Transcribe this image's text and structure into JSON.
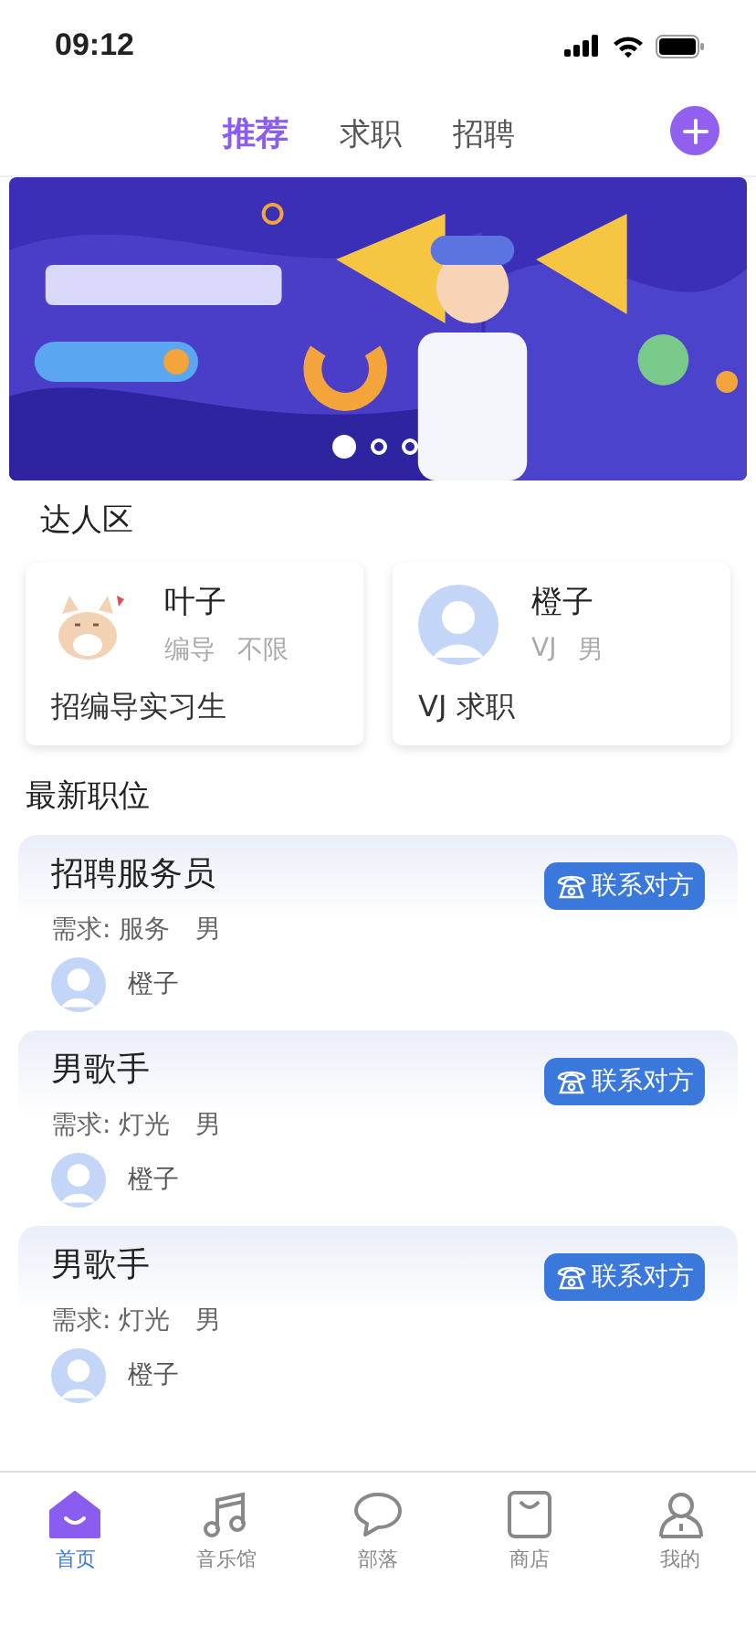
{
  "status_bar": {
    "time": "09:12"
  },
  "top_tabs": [
    {
      "label": "推荐",
      "selected": true
    },
    {
      "label": "求职",
      "selected": false
    },
    {
      "label": "招聘",
      "selected": false
    }
  ],
  "banner": {
    "kind": "picture",
    "dots": [
      {
        "selected": true
      },
      {
        "selected": false
      },
      {
        "selected": false
      }
    ]
  },
  "talent_section": {
    "title": "达人区",
    "cards": [
      {
        "kind": "cat",
        "name": "叶子",
        "tags": [
          "编导",
          "不限"
        ],
        "description": "招编导实习生"
      },
      {
        "kind": "default",
        "name": "橙子",
        "tags": [
          "VJ",
          "男"
        ],
        "description": "VJ 求职"
      }
    ]
  },
  "jobs_section": {
    "title": "最新职位",
    "jobs": [
      {
        "title": "招聘服务员",
        "requirement": "需求: 服务",
        "gender": "男",
        "poster": "橙子",
        "contact_label": "联系对方"
      },
      {
        "title": "男歌手",
        "requirement": "需求: 灯光",
        "gender": "男",
        "poster": "橙子",
        "contact_label": "联系对方"
      },
      {
        "title": "男歌手",
        "requirement": "需求: 灯光",
        "gender": "男",
        "poster": "橙子",
        "contact_label": "联系对方"
      }
    ]
  },
  "tab_bar": [
    {
      "kind": "home",
      "label": "首页",
      "selected": true
    },
    {
      "kind": "music",
      "label": "音乐馆",
      "selected": false
    },
    {
      "kind": "chat",
      "label": "部落",
      "selected": false
    },
    {
      "kind": "bag",
      "label": "商店",
      "selected": false
    },
    {
      "kind": "person",
      "label": "我的",
      "selected": false
    }
  ]
}
